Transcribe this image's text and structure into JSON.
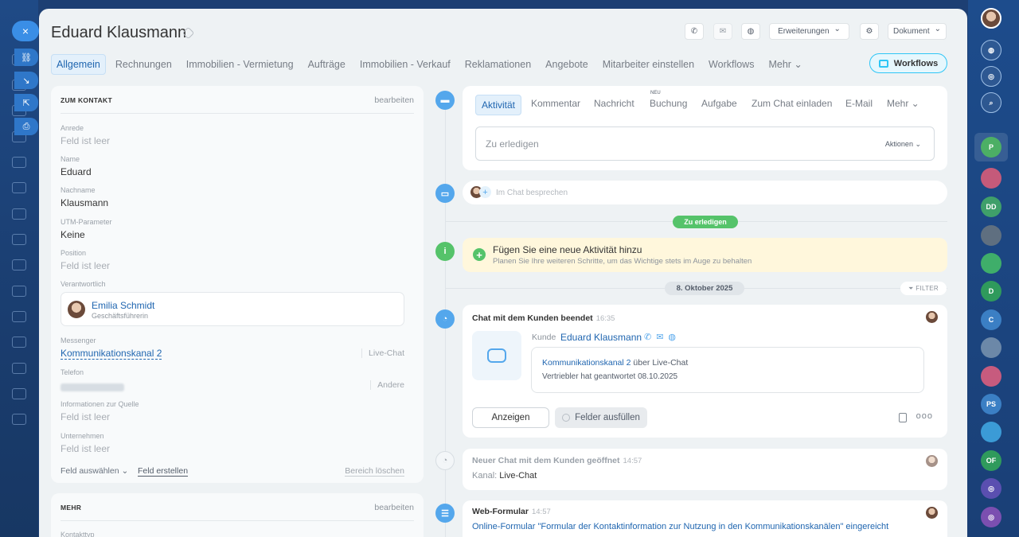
{
  "left_rail": {
    "quick_close": "×"
  },
  "header": {
    "title": "Eduard Klausmann",
    "buttons": {
      "extensions": "Erweiterungen",
      "document": "Dokument"
    }
  },
  "tabs": [
    "Allgemein",
    "Rechnungen",
    "Immobilien - Vermietung",
    "Aufträge",
    "Immobilien - Verkauf",
    "Reklamationen",
    "Angebote",
    "Mitarbeiter einstellen",
    "Workflows",
    "Mehr ⌄"
  ],
  "workflows_button": "Workflows",
  "contact_card": {
    "heading": "ZUM KONTAKT",
    "edit": "bearbeiten",
    "fields": {
      "salutation_label": "Anrede",
      "salutation_value": "Feld ist leer",
      "name_label": "Name",
      "name_value": "Eduard",
      "lastname_label": "Nachname",
      "lastname_value": "Klausmann",
      "utm_label": "UTM-Parameter",
      "utm_value": "Keine",
      "position_label": "Position",
      "position_value": "Feld ist leer",
      "responsible_label": "Verantwortlich",
      "responsible_name": "Emilia Schmidt",
      "responsible_role": "Geschäftsführerin",
      "messenger_label": "Messenger",
      "messenger_value": "Kommunikationskanal 2",
      "messenger_tag": "Live-Chat",
      "phone_label": "Telefon",
      "phone_tag": "Andere",
      "source_label": "Informationen zur Quelle",
      "source_value": "Feld ist leer",
      "company_label": "Unternehmen",
      "company_value": "Feld ist leer"
    },
    "footer": {
      "select_field": "Feld auswählen ⌄",
      "create_field": "Feld erstellen",
      "delete_section": "Bereich löschen"
    }
  },
  "more_card": {
    "heading": "MEHR",
    "edit": "bearbeiten",
    "first_label": "Kontakttyp"
  },
  "activity": {
    "tabs": [
      "Aktivität",
      "Kommentar",
      "Nachricht",
      "Buchung",
      "Aufgabe",
      "Zum Chat einladen",
      "E-Mail",
      "Mehr ⌄"
    ],
    "new_badge": "NEU",
    "todo_placeholder": "Zu erledigen",
    "actions": "Aktionen ⌄"
  },
  "chat_bar": {
    "placeholder": "Im Chat besprechen"
  },
  "todo_pill": "Zu erledigen",
  "tip": {
    "title": "Fügen Sie eine neue Aktivität hinzu",
    "subtitle": "Planen Sie Ihre weiteren Schritte, um das Wichtige stets im Auge zu behalten"
  },
  "date_separator": "8. Oktober 2025",
  "filter": "FILTER",
  "chat_ended": {
    "title": "Chat mit dem Kunden beendet",
    "time": "16:35",
    "customer_label": "Kunde",
    "customer_name": "Eduard Klausmann",
    "channel_link": "Kommunikationskanal 2",
    "channel_suffix": "über Live-Chat",
    "reply_line": "Vertriebler hat geantwortet 08.10.2025",
    "show_button": "Anzeigen",
    "fill_button": "Felder ausfüllen",
    "more_dots": "ooo"
  },
  "chat_opened": {
    "title": "Neuer Chat mit dem Kunden geöffnet",
    "time": "14:57",
    "channel_label": "Kanal:",
    "channel_value": "Live-Chat"
  },
  "web_form": {
    "title": "Web-Formular",
    "time": "14:57",
    "link": "Online-Formular \"Formular der Kontaktinformation zur Nutzung in den Kommunikationskanälen\" eingereicht"
  },
  "right_rail": {
    "items": [
      "P",
      "DD",
      "D",
      "C",
      "PS",
      "OF"
    ]
  },
  "colors": {
    "accent": "#2066b0",
    "green": "#55c36a",
    "timeline_blue": "#54a7ec",
    "workflows_border": "#2fc6f6"
  }
}
